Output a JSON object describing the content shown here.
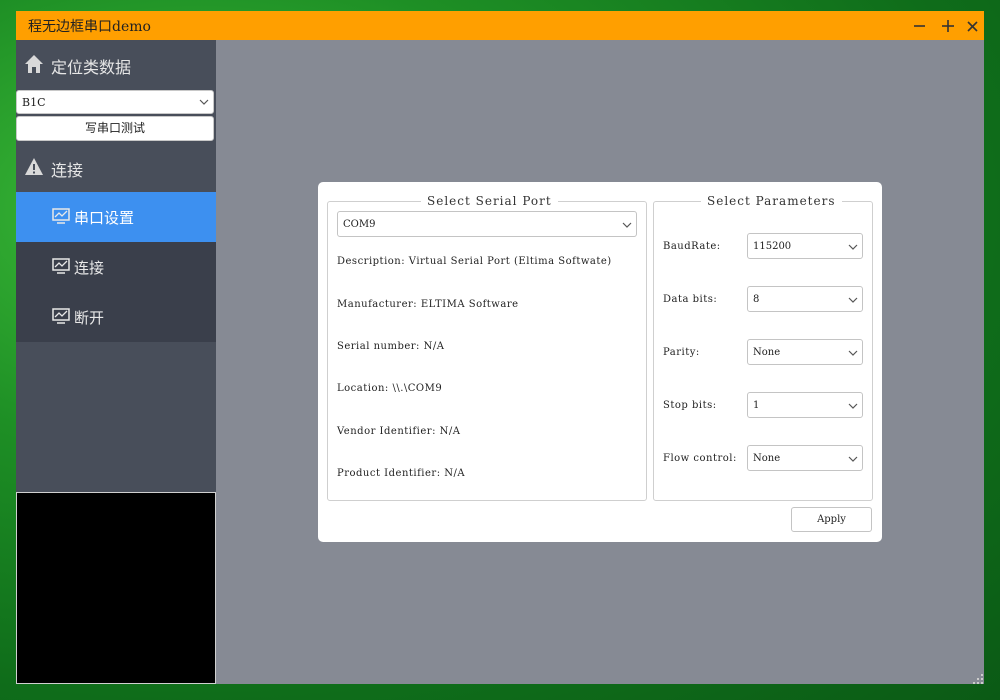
{
  "window": {
    "title": "程无边框串口demo"
  },
  "sidebar": {
    "positioning_title": "定位类数据",
    "positioning_icon": "home-icon",
    "positioning_select": "B1C",
    "write_button": "写串口测试",
    "connect_title": "连接",
    "connect_icon": "warning-icon",
    "items": [
      {
        "label": "串口设置",
        "icon": "monitor-chart-icon",
        "active": true
      },
      {
        "label": "连接",
        "icon": "monitor-chart-icon",
        "active": false
      },
      {
        "label": "断开",
        "icon": "monitor-chart-icon",
        "active": false
      }
    ]
  },
  "serial_port": {
    "title": "Select Serial Port",
    "selected": "COM9",
    "description": "Description: Virtual Serial Port (Eltima Softwate)",
    "manufacturer": "Manufacturer: ELTIMA Software",
    "serial_number": "Serial number: N/A",
    "location": "Location: \\\\.\\COM9",
    "vendor": "Vendor Identifier: N/A",
    "product": "Product Identifier: N/A"
  },
  "parameters": {
    "title": "Select Parameters",
    "fields": [
      {
        "label": "BaudRate:",
        "value": "115200"
      },
      {
        "label": "Data bits:",
        "value": "8"
      },
      {
        "label": "Parity:",
        "value": "None"
      },
      {
        "label": "Stop bits:",
        "value": "1"
      },
      {
        "label": "Flow control:",
        "value": "None"
      }
    ]
  },
  "apply_label": "Apply",
  "colors": {
    "titlebar": "#ff9f00",
    "sidebar": "#484e5a",
    "nav_bg": "#3a3f4b",
    "active": "#3d90f0",
    "content": "#868a94"
  }
}
